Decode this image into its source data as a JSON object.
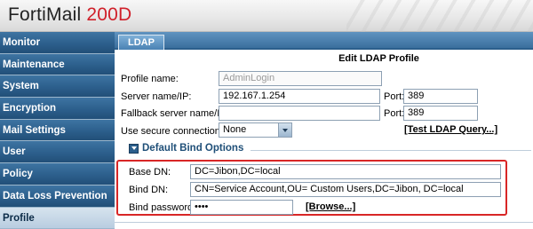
{
  "app": {
    "brand_name": "FortiMail",
    "brand_model": "200D"
  },
  "sidebar": {
    "items": [
      {
        "label": "Monitor"
      },
      {
        "label": "Maintenance"
      },
      {
        "label": "System"
      },
      {
        "label": "Encryption"
      },
      {
        "label": "Mail Settings"
      },
      {
        "label": "User"
      },
      {
        "label": "Policy"
      },
      {
        "label": "Data Loss Prevention"
      },
      {
        "label": "Profile",
        "active": true
      }
    ]
  },
  "tab": {
    "label": "LDAP"
  },
  "form": {
    "title": "Edit LDAP Profile",
    "profile_name": {
      "label": "Profile name:",
      "value": "AdminLogin"
    },
    "server": {
      "label": "Server name/IP:",
      "value": "192.167.1.254",
      "port_label": "Port:",
      "port_value": "389"
    },
    "fallback": {
      "label": "Fallback server name/IP:",
      "value": "",
      "port_label": "Port:",
      "port_value": "389"
    },
    "secure": {
      "label": "Use secure connection:",
      "value": "None"
    },
    "test_link": "[Test LDAP Query...]"
  },
  "bind_options": {
    "section_title": "Default Bind Options",
    "base_dn": {
      "label": "Base DN:",
      "value": "DC=Jibon,DC=local"
    },
    "bind_dn": {
      "label": "Bind DN:",
      "value": "CN=Service Account,OU= Custom Users,DC=Jibon, DC=local"
    },
    "bind_password": {
      "label": "Bind password:",
      "value": "••••"
    },
    "browse_link": "[Browse...]"
  },
  "colors": {
    "brand_red": "#d0202a",
    "nav_blue": "#2c5f8c",
    "highlight_border": "#d82626"
  }
}
